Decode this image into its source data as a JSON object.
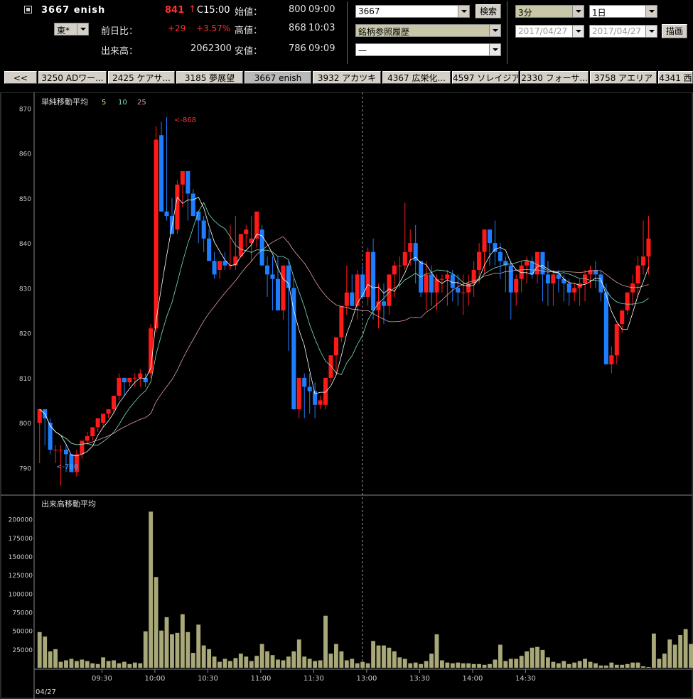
{
  "header": {
    "code_name": "3667 enish",
    "price": "841",
    "arrow": "↑",
    "time": "C15:00",
    "open_label": "始値：",
    "open_value": "800",
    "open_time": "09:00",
    "exchange": "東*",
    "change_label": "前日比：",
    "change": "+29",
    "change_pct": "+3.57%",
    "high_label": "高値：",
    "high_value": "868",
    "high_time": "10:03",
    "volume_label": "出来高：",
    "volume_value": "2062300",
    "low_label": "安値：",
    "low_value": "786",
    "low_time": "09:09"
  },
  "controls": {
    "code_input": "3667",
    "search_button": "検索",
    "history_select": "銘柄参照履歴",
    "third_select": "一",
    "interval_select": "3分",
    "period_select": "1日",
    "date_from": "2017/04/27",
    "date_to": "2017/04/27",
    "draw_button": "描画"
  },
  "tabs": [
    "<<",
    "3250 ADワー...",
    "2425 ケアサ...",
    "3185 夢展望",
    "3667 enish",
    "3932 アカツキ",
    "4367 広栄化...",
    "4597 ソレイジア",
    "2330 フォーサ...",
    "3758 アエリア",
    "4341 西"
  ],
  "colors": {
    "up": "#ff1a1a",
    "down": "#1e7eff",
    "ma5": "#ffffff",
    "ma10": "#7fe0c0",
    "ma25": "#e8a0a0",
    "volume": "#a8a878",
    "grid": "#3a3a3a"
  },
  "chart_data": [
    {
      "type": "candlestick",
      "title": "単純移動平均",
      "ma_periods": [
        "5",
        "10",
        "25"
      ],
      "ylim": [
        785,
        871
      ],
      "y_ticks": [
        870,
        860,
        850,
        840,
        830,
        820,
        810,
        800,
        790
      ],
      "x_ticks": [
        "09:30",
        "10:00",
        "10:30",
        "11:00",
        "11:30",
        "13:00",
        "13:30",
        "14:00",
        "14:30"
      ],
      "date_label": "04/27",
      "high_annotation": "<-868",
      "low_annotation": "<-786",
      "candles": [
        [
          800,
          803,
          791,
          803
        ],
        [
          803,
          803,
          795,
          801
        ],
        [
          800,
          801,
          793,
          794
        ],
        [
          794,
          795,
          791,
          794
        ],
        [
          794,
          795,
          786,
          794
        ],
        [
          794,
          795,
          789,
          793
        ],
        [
          793,
          793,
          789,
          789
        ],
        [
          789,
          794,
          788,
          793
        ],
        [
          793,
          796,
          792,
          796
        ],
        [
          796,
          798,
          795,
          797
        ],
        [
          797,
          799,
          796,
          799
        ],
        [
          799,
          801,
          798,
          801
        ],
        [
          800,
          802,
          799,
          802
        ],
        [
          802,
          803,
          801,
          803
        ],
        [
          803,
          806,
          802,
          806
        ],
        [
          806,
          811,
          805,
          810
        ],
        [
          810,
          810,
          806,
          809
        ],
        [
          809,
          810,
          808,
          810
        ],
        [
          810,
          811,
          808,
          810
        ],
        [
          810,
          812,
          808,
          811
        ],
        [
          810,
          811,
          808,
          809
        ],
        [
          811,
          822,
          810,
          821
        ],
        [
          821,
          866,
          820,
          863
        ],
        [
          864,
          867,
          847,
          847
        ],
        [
          847,
          868,
          845,
          846
        ],
        [
          846,
          850,
          842,
          842
        ],
        [
          843,
          854,
          842,
          853
        ],
        [
          853,
          856,
          848,
          856
        ],
        [
          856,
          856,
          845,
          851
        ],
        [
          851,
          852,
          846,
          846
        ],
        [
          847,
          847,
          840,
          845
        ],
        [
          845,
          846,
          838,
          841
        ],
        [
          841,
          843,
          837,
          836
        ],
        [
          836,
          838,
          832,
          833
        ],
        [
          834,
          836,
          832,
          836
        ],
        [
          836,
          838,
          834,
          835
        ],
        [
          835,
          844,
          834,
          835
        ],
        [
          835,
          846,
          834,
          837
        ],
        [
          837,
          842,
          837,
          842
        ],
        [
          842,
          844,
          839,
          843
        ],
        [
          840,
          846,
          836,
          841
        ],
        [
          841,
          847,
          839,
          847
        ],
        [
          843,
          844,
          835,
          835
        ],
        [
          835,
          837,
          828,
          833
        ],
        [
          833,
          837,
          825,
          832
        ],
        [
          832,
          837,
          826,
          825
        ],
        [
          825,
          835,
          823,
          835
        ],
        [
          835,
          836,
          816,
          830
        ],
        [
          830,
          832,
          817,
          803
        ],
        [
          803,
          810,
          801,
          810
        ],
        [
          810,
          811,
          801,
          808
        ],
        [
          808,
          811,
          802,
          807
        ],
        [
          807,
          809,
          801,
          804
        ],
        [
          804,
          806,
          803,
          805
        ],
        [
          804,
          810,
          803,
          810
        ],
        [
          810,
          815,
          809,
          815
        ],
        [
          815,
          819,
          811,
          819
        ],
        [
          819,
          825,
          818,
          826
        ],
        [
          826,
          835,
          824,
          829
        ],
        [
          829,
          833,
          826,
          826
        ],
        [
          826,
          834,
          823,
          833
        ],
        [
          833,
          835,
          828,
          828
        ],
        [
          828,
          839,
          826,
          838
        ],
        [
          838,
          841,
          823,
          825
        ],
        [
          825,
          831,
          821,
          827
        ],
        [
          827,
          831,
          822,
          826
        ],
        [
          826,
          833,
          824,
          833
        ],
        [
          833,
          836,
          828,
          835
        ],
        [
          835,
          837,
          830,
          835
        ],
        [
          835,
          849,
          834,
          838
        ],
        [
          838,
          843,
          835,
          840
        ],
        [
          840,
          844,
          831,
          836
        ],
        [
          836,
          836,
          828,
          829
        ],
        [
          829,
          836,
          825,
          833
        ],
        [
          833,
          835,
          826,
          829
        ],
        [
          829,
          833,
          825,
          832
        ],
        [
          832,
          833,
          829,
          832
        ],
        [
          832,
          834,
          826,
          833
        ],
        [
          833,
          834,
          827,
          830
        ],
        [
          830,
          833,
          826,
          829
        ],
        [
          829,
          833,
          824,
          829
        ],
        [
          829,
          833,
          826,
          831
        ],
        [
          831,
          836,
          828,
          834
        ],
        [
          834,
          840,
          831,
          838
        ],
        [
          838,
          843,
          833,
          843
        ],
        [
          843,
          843,
          835,
          840
        ],
        [
          840,
          845,
          835,
          838
        ],
        [
          838,
          840,
          832,
          836
        ],
        [
          836,
          837,
          829,
          835
        ],
        [
          835,
          836,
          823,
          829
        ],
        [
          829,
          833,
          826,
          832
        ],
        [
          832,
          836,
          829,
          835
        ],
        [
          835,
          837,
          831,
          836
        ],
        [
          836,
          837,
          832,
          833
        ],
        [
          833,
          838,
          831,
          838
        ],
        [
          838,
          838,
          827,
          833
        ],
        [
          833,
          836,
          826,
          831
        ],
        [
          831,
          834,
          826,
          833
        ],
        [
          833,
          834,
          829,
          832
        ],
        [
          832,
          833,
          827,
          831
        ],
        [
          831,
          832,
          826,
          829
        ],
        [
          829,
          831,
          827,
          830
        ],
        [
          830,
          832,
          826,
          831
        ],
        [
          831,
          834,
          827,
          833
        ],
        [
          833,
          835,
          830,
          834
        ],
        [
          834,
          836,
          830,
          833
        ],
        [
          833,
          834,
          827,
          829
        ],
        [
          829,
          831,
          813,
          813
        ],
        [
          813,
          817,
          811,
          815
        ],
        [
          815,
          822,
          813,
          822
        ],
        [
          822,
          825,
          820,
          825
        ],
        [
          825,
          829,
          824,
          829
        ],
        [
          829,
          833,
          826,
          831
        ],
        [
          831,
          837,
          828,
          835
        ],
        [
          835,
          845,
          833,
          837
        ],
        [
          837,
          846,
          833,
          841
        ]
      ]
    },
    {
      "type": "bar",
      "title": "出来高移動平均",
      "ylim": [
        0,
        215000
      ],
      "y_ticks": [
        200000,
        175000,
        150000,
        125000,
        100000,
        75000,
        50000,
        25000
      ],
      "values": [
        48000,
        42000,
        22000,
        25000,
        8000,
        10000,
        12000,
        9000,
        11000,
        9000,
        6000,
        5000,
        14000,
        9000,
        10000,
        6000,
        8000,
        5000,
        7000,
        6000,
        49000,
        210000,
        122000,
        50000,
        68000,
        45000,
        47000,
        72000,
        48000,
        20000,
        58000,
        30000,
        25000,
        15000,
        8000,
        12000,
        9000,
        13000,
        19000,
        15000,
        9000,
        16000,
        32000,
        22000,
        17000,
        11000,
        10000,
        15000,
        22000,
        38000,
        15000,
        12000,
        9000,
        10000,
        70000,
        19000,
        32000,
        22000,
        10000,
        12000,
        6000,
        8000,
        6000,
        36000,
        30000,
        30000,
        27000,
        22000,
        14000,
        12000,
        6000,
        7000,
        5000,
        9000,
        19000,
        45000,
        10000,
        7000,
        6000,
        7000,
        6000,
        6000,
        5000,
        5000,
        4000,
        5000,
        11000,
        31000,
        9000,
        12000,
        12000,
        16000,
        22000,
        27000,
        28000,
        24000,
        14000,
        8000,
        6000,
        9000,
        5000,
        7000,
        9000,
        12000,
        8000,
        6000,
        3000,
        3000,
        7000,
        4000,
        4000,
        5000,
        7000,
        7000,
        2000,
        1000,
        46000,
        12000,
        19000,
        38000,
        31000,
        44000,
        52000,
        32000
      ]
    }
  ]
}
